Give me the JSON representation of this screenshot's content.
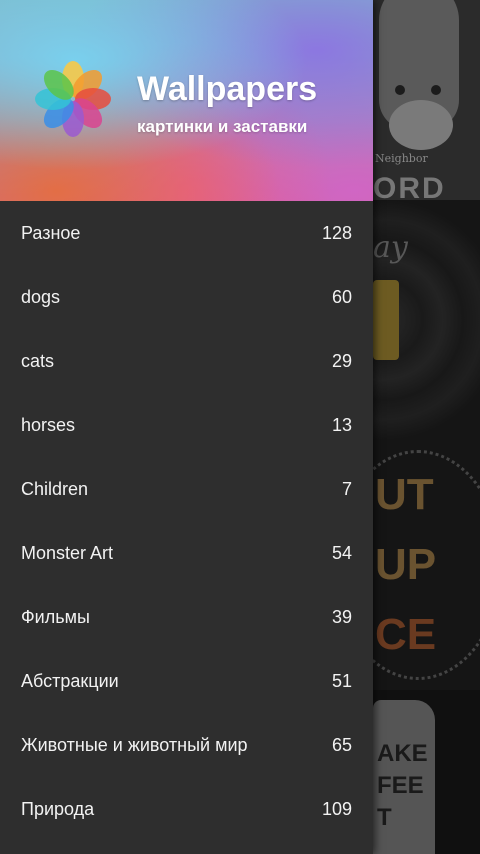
{
  "header": {
    "title": "Wallpapers",
    "subtitle": "картинки и заставки",
    "logo_icon": "flower-photos-icon"
  },
  "menu": {
    "items": [
      {
        "label": "Разное",
        "count": "128"
      },
      {
        "label": "dogs",
        "count": "60"
      },
      {
        "label": "cats",
        "count": "29"
      },
      {
        "label": "horses",
        "count": "13"
      },
      {
        "label": "Children",
        "count": "7"
      },
      {
        "label": "Monster Art",
        "count": "54"
      },
      {
        "label": "Фильмы",
        "count": "39"
      },
      {
        "label": "Абстракции",
        "count": "51"
      },
      {
        "label": "Животные и животный мир",
        "count": "65"
      },
      {
        "label": "Природа",
        "count": "109"
      }
    ]
  },
  "background": {
    "tile1_caption": "Neighbor",
    "tile1_big": "ORD",
    "tile2_text": "ay",
    "tile3_lines": [
      "UT",
      "UP",
      "CE"
    ],
    "tile4_lines": [
      "AKE",
      "FEE",
      "T"
    ]
  },
  "colors": {
    "drawer_bg": "#2e2e2e",
    "text": "#f2f2f2",
    "scrim": "#000000"
  }
}
